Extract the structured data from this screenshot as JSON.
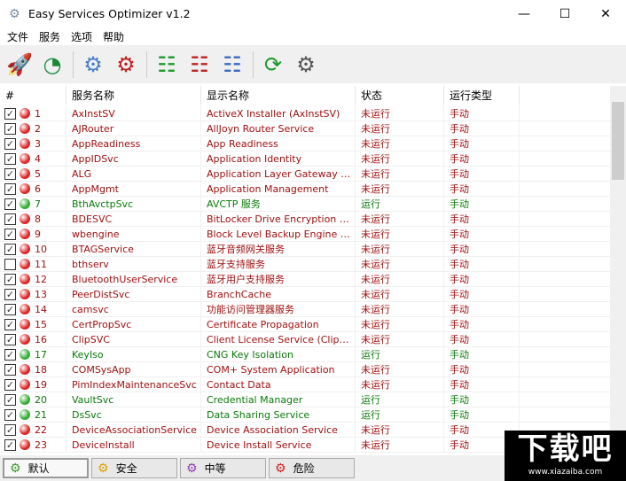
{
  "window": {
    "title": "Easy Services Optimizer v1.2",
    "minimize": "—",
    "maximize": "☐",
    "close": "✕"
  },
  "menu": [
    "文件",
    "服务",
    "选项",
    "帮助"
  ],
  "toolbar": [
    "rocket-icon",
    "restore-icon",
    "start-service-icon",
    "stop-service-icon",
    "add-list-icon",
    "remove-list-icon",
    "list-settings-icon",
    "refresh-icon",
    "settings-icon"
  ],
  "columns": [
    "#",
    "服务名称",
    "显示名称",
    "状态",
    "运行类型"
  ],
  "colors": {
    "stopped": "#a01010",
    "running": "#0a7a0a"
  },
  "rows": [
    {
      "checked": true,
      "n": "1",
      "name": "AxInstSV",
      "display": "ActiveX Installer (AxInstSV)",
      "status": "未运行",
      "type": "手动",
      "running": false
    },
    {
      "checked": true,
      "n": "2",
      "name": "AJRouter",
      "display": "AllJoyn Router Service",
      "status": "未运行",
      "type": "手动",
      "running": false
    },
    {
      "checked": true,
      "n": "3",
      "name": "AppReadiness",
      "display": "App Readiness",
      "status": "未运行",
      "type": "手动",
      "running": false
    },
    {
      "checked": true,
      "n": "4",
      "name": "AppIDSvc",
      "display": "Application Identity",
      "status": "未运行",
      "type": "手动",
      "running": false
    },
    {
      "checked": true,
      "n": "5",
      "name": "ALG",
      "display": "Application Layer Gateway Ser...",
      "status": "未运行",
      "type": "手动",
      "running": false
    },
    {
      "checked": true,
      "n": "6",
      "name": "AppMgmt",
      "display": "Application Management",
      "status": "未运行",
      "type": "手动",
      "running": false
    },
    {
      "checked": true,
      "n": "7",
      "name": "BthAvctpSvc",
      "display": "AVCTP 服务",
      "status": "运行",
      "type": "手动",
      "running": true
    },
    {
      "checked": true,
      "n": "8",
      "name": "BDESVC",
      "display": "BitLocker Drive Encryption Service",
      "status": "未运行",
      "type": "手动",
      "running": false
    },
    {
      "checked": true,
      "n": "9",
      "name": "wbengine",
      "display": "Block Level Backup Engine Service",
      "status": "未运行",
      "type": "手动",
      "running": false
    },
    {
      "checked": true,
      "n": "10",
      "name": "BTAGService",
      "display": "蓝牙音频网关服务",
      "status": "未运行",
      "type": "手动",
      "running": false
    },
    {
      "checked": false,
      "n": "11",
      "name": "bthserv",
      "display": "蓝牙支持服务",
      "status": "未运行",
      "type": "手动",
      "running": false
    },
    {
      "checked": true,
      "n": "12",
      "name": "BluetoothUserService",
      "display": "蓝牙用户支持服务",
      "status": "未运行",
      "type": "手动",
      "running": false
    },
    {
      "checked": true,
      "n": "13",
      "name": "PeerDistSvc",
      "display": "BranchCache",
      "status": "未运行",
      "type": "手动",
      "running": false
    },
    {
      "checked": true,
      "n": "14",
      "name": "camsvc",
      "display": "功能访问管理器服务",
      "status": "未运行",
      "type": "手动",
      "running": false
    },
    {
      "checked": true,
      "n": "15",
      "name": "CertPropSvc",
      "display": "Certificate Propagation",
      "status": "未运行",
      "type": "手动",
      "running": false
    },
    {
      "checked": true,
      "n": "16",
      "name": "ClipSVC",
      "display": "Client License Service (ClipSVC)",
      "status": "未运行",
      "type": "手动",
      "running": false
    },
    {
      "checked": true,
      "n": "17",
      "name": "KeyIso",
      "display": "CNG Key Isolation",
      "status": "运行",
      "type": "手动",
      "running": true
    },
    {
      "checked": true,
      "n": "18",
      "name": "COMSysApp",
      "display": "COM+ System Application",
      "status": "未运行",
      "type": "手动",
      "running": false
    },
    {
      "checked": true,
      "n": "19",
      "name": "PimIndexMaintenanceSvc",
      "display": "Contact Data",
      "status": "未运行",
      "type": "手动",
      "running": false
    },
    {
      "checked": true,
      "n": "20",
      "name": "VaultSvc",
      "display": "Credential Manager",
      "status": "运行",
      "type": "手动",
      "running": true
    },
    {
      "checked": true,
      "n": "21",
      "name": "DsSvc",
      "display": "Data Sharing Service",
      "status": "运行",
      "type": "手动",
      "running": true
    },
    {
      "checked": true,
      "n": "22",
      "name": "DeviceAssociationService",
      "display": "Device Association Service",
      "status": "未运行",
      "type": "手动",
      "running": false
    },
    {
      "checked": true,
      "n": "23",
      "name": "DeviceInstall",
      "display": "Device Install Service",
      "status": "未运行",
      "type": "手动",
      "running": false
    }
  ],
  "tabs": [
    {
      "label": "默认",
      "color": "#3a9a2a"
    },
    {
      "label": "安全",
      "color": "#e0a000"
    },
    {
      "label": "中等",
      "color": "#9040b0"
    },
    {
      "label": "危险",
      "color": "#d02020"
    }
  ],
  "watermark": {
    "big": "下载吧",
    "small": "www.xiazaiba.com"
  }
}
